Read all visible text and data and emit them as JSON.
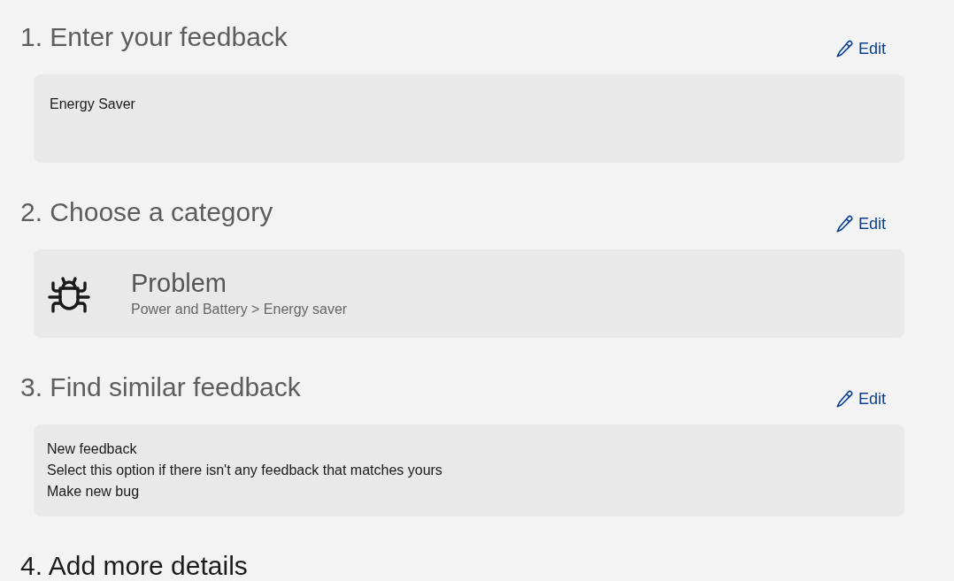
{
  "steps": [
    {
      "heading": "1. Enter your feedback",
      "active": false,
      "edit_label": "Edit",
      "card": {
        "kind": "text",
        "text": "Energy Saver"
      }
    },
    {
      "heading": "2. Choose a category",
      "active": false,
      "edit_label": "Edit",
      "card": {
        "kind": "category",
        "title": "Problem",
        "path": "Power and Battery > Energy saver"
      }
    },
    {
      "heading": "3. Find similar feedback",
      "active": false,
      "edit_label": "Edit",
      "card": {
        "kind": "lines",
        "lines": [
          "New feedback",
          "Select this option if there isn't any feedback that matches yours",
          "Make new bug"
        ]
      }
    },
    {
      "heading": "4. Add more details",
      "active": true
    }
  ]
}
